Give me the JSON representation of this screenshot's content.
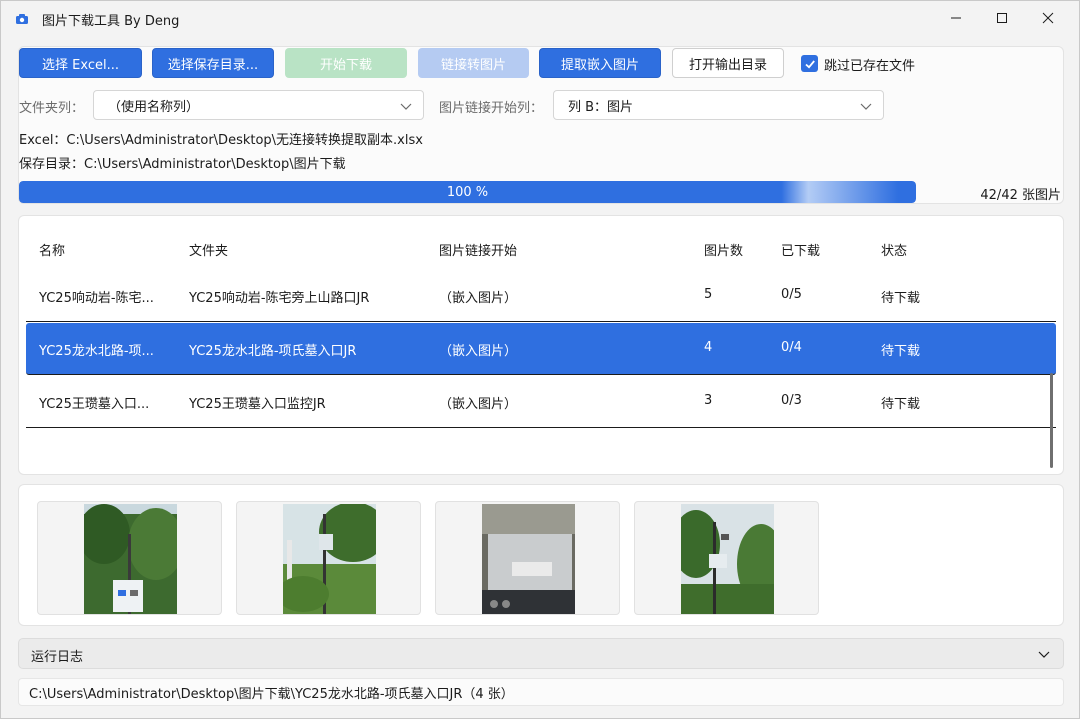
{
  "window": {
    "title": "图片下载工具 By Deng",
    "controls": [
      "minimize",
      "maximize",
      "close"
    ]
  },
  "toolbar": {
    "select_excel": "选择 Excel...",
    "select_save_dir": "选择保存目录...",
    "start_download": "开始下载",
    "link_to_image": "链接转图片",
    "extract_embedded": "提取嵌入图片",
    "open_output_dir": "打开输出目录",
    "skip_existing_label": "跳过已存在文件",
    "skip_existing_checked": true
  },
  "options": {
    "folder_column_label": "文件夹列：",
    "folder_column_value": "（使用名称列）",
    "link_start_label": "图片链接开始列：",
    "link_start_value": "列 B：图片"
  },
  "paths": {
    "excel": "Excel：C:\\Users\\Administrator\\Desktop\\无连接转换提取副本.xlsx",
    "save_dir": "保存目录：C:\\Users\\Administrator\\Desktop\\图片下载"
  },
  "progress": {
    "percent": 100,
    "label": "100 %",
    "count": "42/42 张图片"
  },
  "table": {
    "headers": {
      "name": "名称",
      "folder": "文件夹",
      "link_start": "图片链接开始",
      "image_count": "图片数",
      "downloaded": "已下载",
      "status": "状态"
    },
    "rows": [
      {
        "name": "YC25响动岩-陈宅...",
        "folder": "YC25响动岩-陈宅旁上山路口JR",
        "link_start": "（嵌入图片）",
        "image_count": "5",
        "downloaded": "0/5",
        "status": "待下载",
        "selected": false
      },
      {
        "name": "YC25龙水北路-项...",
        "folder": "YC25龙水北路-项氏墓入口JR",
        "link_start": "（嵌入图片）",
        "image_count": "4",
        "downloaded": "0/4",
        "status": "待下载",
        "selected": true
      },
      {
        "name": "YC25王瓒墓入口...",
        "folder": "YC25王瓒墓入口监控JR",
        "link_start": "（嵌入图片）",
        "image_count": "3",
        "downloaded": "0/3",
        "status": "待下载",
        "selected": false
      }
    ]
  },
  "thumbnails": [
    {
      "icon": "photo-weather-station-tall-1"
    },
    {
      "icon": "photo-weather-station-field"
    },
    {
      "icon": "photo-equipment-closeup"
    },
    {
      "icon": "photo-weather-station-tall-2"
    }
  ],
  "log": {
    "title": "运行日志",
    "line": "C:\\Users\\Administrator\\Desktop\\图片下载\\YC25龙水北路-项氏墓入口JR（4 张）"
  },
  "colors": {
    "accent": "#2f6fe0",
    "disabled_green": "#b9e3c5",
    "disabled_blue": "#b5cbf2"
  }
}
